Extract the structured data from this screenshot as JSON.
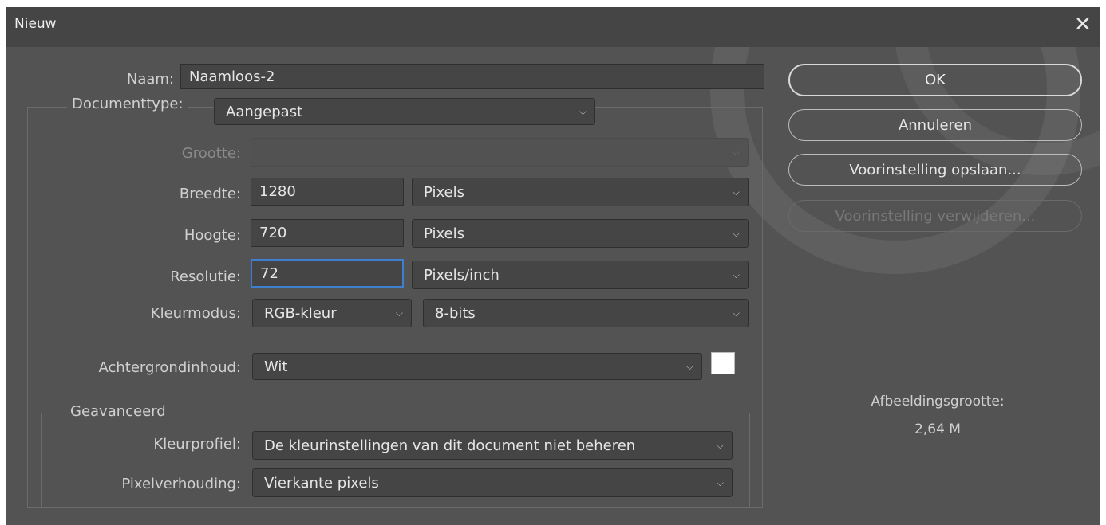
{
  "dialog": {
    "title": "Nieuw",
    "close_glyph": "✕",
    "close_icon": "close-icon"
  },
  "form": {
    "name_label": "Naam:",
    "name_value": "Naamloos-2",
    "doctype_label": "Documenttype:",
    "doctype_value": "Aangepast",
    "size_label": "Grootte:",
    "size_value": "",
    "width_label": "Breedte:",
    "width_value": "1280",
    "width_unit": "Pixels",
    "height_label": "Hoogte:",
    "height_value": "720",
    "height_unit": "Pixels",
    "resolution_label": "Resolutie:",
    "resolution_value": "72",
    "resolution_unit": "Pixels/inch",
    "colormode_label": "Kleurmodus:",
    "colormode_value": "RGB-kleur",
    "bitdepth_value": "8-bits",
    "background_label": "Achtergrondinhoud:",
    "background_value": "Wit",
    "background_color": "#ffffff"
  },
  "advanced": {
    "legend": "Geavanceerd",
    "profile_label": "Kleurprofiel:",
    "profile_value": "De kleurinstellingen van dit document niet beheren",
    "pixelratio_label": "Pixelverhouding:",
    "pixelratio_value": "Vierkante pixels"
  },
  "buttons": {
    "ok": "OK",
    "cancel": "Annuleren",
    "save_preset": "Voorinstelling opslaan...",
    "delete_preset": "Voorinstelling verwijderen..."
  },
  "info": {
    "image_size_label": "Afbeeldingsgrootte:",
    "image_size_value": "2,64 M"
  },
  "icons": {
    "dropdown": "chevron-down-icon",
    "chevron_glyph": "⌵"
  },
  "colors": {
    "dialog_bg": "#535353",
    "titlebar_bg": "#454545",
    "focus_border": "#3f7fcf"
  }
}
